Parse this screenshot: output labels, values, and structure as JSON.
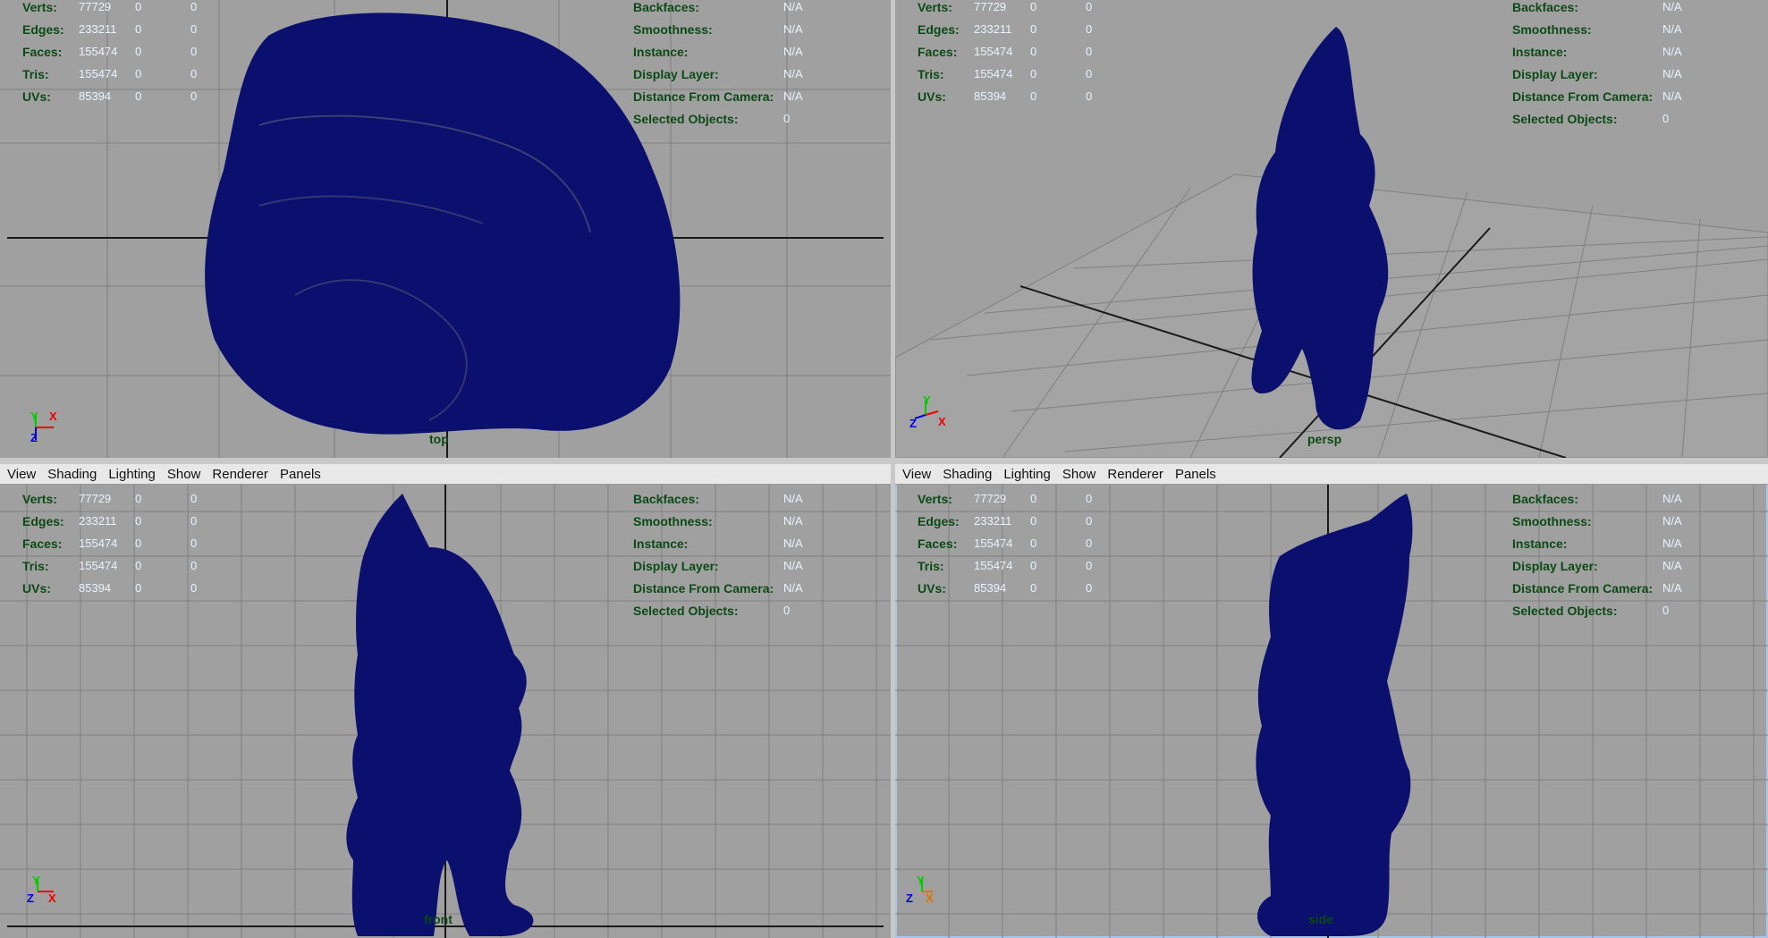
{
  "menu": [
    "View",
    "Shading",
    "Lighting",
    "Show",
    "Renderer",
    "Panels"
  ],
  "hud_left": [
    {
      "label": "Verts:",
      "values": [
        "77729",
        "0",
        "0"
      ]
    },
    {
      "label": "Edges:",
      "values": [
        "233211",
        "0",
        "0"
      ]
    },
    {
      "label": "Faces:",
      "values": [
        "155474",
        "0",
        "0"
      ]
    },
    {
      "label": "Tris:",
      "values": [
        "155474",
        "0",
        "0"
      ]
    },
    {
      "label": "UVs:",
      "values": [
        "85394",
        "0",
        "0"
      ]
    }
  ],
  "hud_right": [
    {
      "label": "Backfaces:",
      "value": "N/A"
    },
    {
      "label": "Smoothness:",
      "value": "N/A"
    },
    {
      "label": "Instance:",
      "value": "N/A"
    },
    {
      "label": "Display Layer:",
      "value": "N/A"
    },
    {
      "label": "Distance From Camera:",
      "value": "N/A"
    },
    {
      "label": "Selected Objects:",
      "value": "0"
    }
  ],
  "panes": {
    "top": {
      "camera": "top",
      "axis": [
        "Y",
        "X",
        "Z"
      ]
    },
    "persp": {
      "camera": "persp",
      "axis": [
        "Y",
        "Z",
        "X"
      ]
    },
    "front": {
      "camera": "front",
      "axis": [
        "Y",
        "Z",
        "X"
      ]
    },
    "side": {
      "camera": "side",
      "axis": [
        "Y",
        "Z",
        "X"
      ]
    }
  },
  "colors": {
    "viewport_bg": "#a0a0a0",
    "mesh": "#0b0f6e",
    "grid": "#7f7f7f",
    "axis_line": "#1a1a1a",
    "hud_label": "#0b4a14"
  }
}
